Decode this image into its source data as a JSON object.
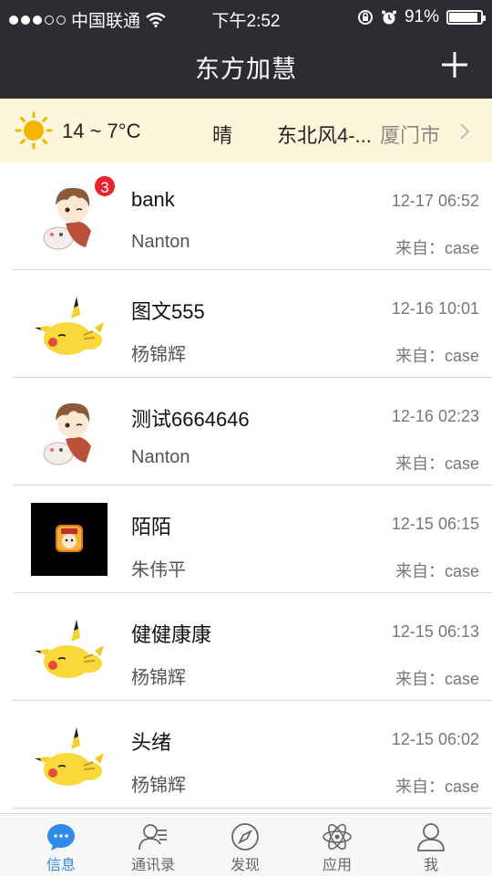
{
  "status_bar": {
    "carrier": "中国联通",
    "time": "下午2:52",
    "battery": "91%",
    "battery_level": 0.91
  },
  "nav": {
    "title": "东方加慧",
    "add_icon": "plus-icon"
  },
  "weather": {
    "temp": "14 ~ 7°C",
    "condition": "晴",
    "wind": "东北风4-...",
    "city": "厦门市",
    "icon": "sun-icon"
  },
  "messages": [
    {
      "title": "bank",
      "sender": "Nanton",
      "time": "12-17 06:52",
      "source": "来自：case",
      "avatar": "anime-boy-avatar",
      "badge": "3"
    },
    {
      "title": "图文555",
      "sender": "杨锦辉",
      "time": "12-16 10:01",
      "source": "来自：case",
      "avatar": "pikachu-avatar"
    },
    {
      "title": "测试6664646",
      "sender": "Nanton",
      "time": "12-16 02:23",
      "source": "来自：case",
      "avatar": "anime-boy-avatar"
    },
    {
      "title": "陌陌",
      "sender": "朱伟平",
      "time": "12-15 06:15",
      "source": "来自：case",
      "avatar": "game-app-avatar"
    },
    {
      "title": "健健康康",
      "sender": "杨锦辉",
      "time": "12-15 06:13",
      "source": "来自：case",
      "avatar": "pikachu-avatar"
    },
    {
      "title": "头绪",
      "sender": "杨锦辉",
      "time": "12-15 06:02",
      "source": "来自：case",
      "avatar": "pikachu-avatar"
    }
  ],
  "tabs": [
    {
      "label": "信息",
      "icon": "chat-bubble-icon",
      "active": true
    },
    {
      "label": "通讯录",
      "icon": "contacts-icon",
      "active": false
    },
    {
      "label": "发现",
      "icon": "compass-icon",
      "active": false
    },
    {
      "label": "应用",
      "icon": "atom-icon",
      "active": false
    },
    {
      "label": "我",
      "icon": "person-icon",
      "active": false
    }
  ],
  "colors": {
    "nav_bg": "#2b2d31",
    "weather_bg": "#fdf6da",
    "accent": "#2f8be8",
    "badge": "#e8232b"
  }
}
